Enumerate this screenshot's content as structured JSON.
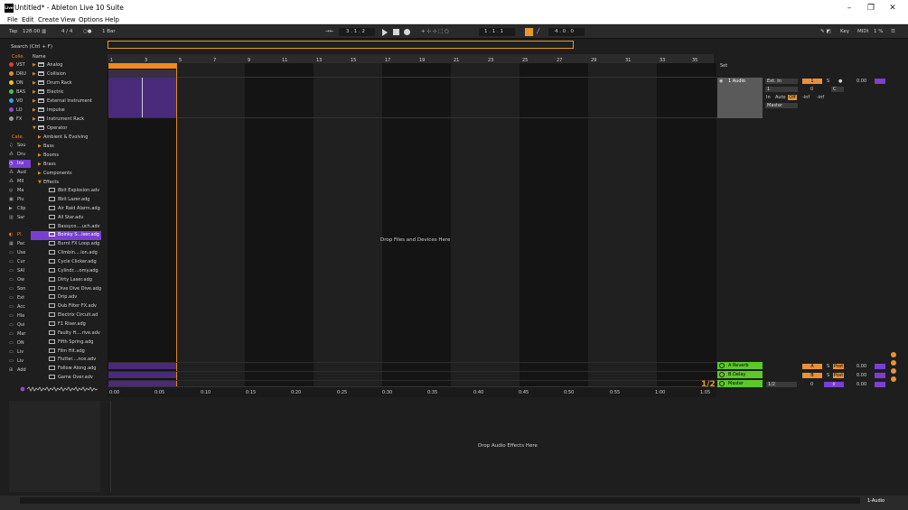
{
  "window": {
    "title": "Untitled* - Ableton Live 10 Suite",
    "app_icon": "Live",
    "minimize": "–",
    "maximize": "❐",
    "close": "✕"
  },
  "menu": [
    "File",
    "Edit",
    "Create",
    "View",
    "Options",
    "Help"
  ],
  "transport": {
    "tap": "Tap",
    "tempo": "128.00",
    "sig": "4 / 4",
    "quant": "1 Bar",
    "arr_pos": "3 .   1 .   2",
    "loop_pos": "1 .   1 .   1",
    "loop_len": "4 .   0 .   0",
    "key": "Key",
    "midi": "MIDI",
    "cpu": "1 %"
  },
  "browser": {
    "search": "Search (Ctrl + F)",
    "col_collections": "Colle.",
    "col_name": "Name",
    "collections": [
      {
        "label": "VST",
        "color": "#e23b3b"
      },
      {
        "label": "DRU",
        "color": "#e6892c"
      },
      {
        "label": "ON",
        "color": "#e6c42c"
      },
      {
        "label": "BAS",
        "color": "#4cc24a"
      },
      {
        "label": "VO",
        "color": "#3aa0e6"
      },
      {
        "label": "LO",
        "color": "#8a4ad6"
      },
      {
        "label": "FX",
        "color": "#9a9a9a"
      }
    ],
    "categories_head": "Cate.",
    "categories": [
      "Sou",
      "Dru",
      "Ins",
      "Aud",
      "MII",
      "Ma",
      "Plu",
      "Clip",
      "Sar"
    ],
    "places_head": "Pl.",
    "places": [
      "Pac",
      "Use",
      "Cur",
      "SAI",
      "Ow",
      "Son",
      "Ext",
      "Acc",
      "Hla",
      "Qui",
      "Mar",
      "DN",
      "Liv",
      "Liv",
      "Add"
    ],
    "items": [
      "Analog",
      "Collision",
      "Drum Rack",
      "Electric",
      "External Instrument",
      "Impulse",
      "Instrument Rack",
      "Operator",
      "Ambient & Evolving",
      "Bass",
      "Booms",
      "Brass",
      "Components",
      "Effects",
      "8bit Explosion.adv",
      "8bit Lazer.adg",
      "Air Raid Alarm.adg",
      "All Star.adv",
      "Bassyco....uch.adv",
      "Boinky S...iser.adg",
      "Burnt FX Loop.adg",
      "Climbin....ion.adg",
      "Cycle Clicker.adg",
      "Cylindr....omy.adg",
      "Dirty Laser.adg",
      "Dive Dive Dive.adg",
      "Drip.adv",
      "Dub Filter FX.adv",
      "Electrix Circuit.ad",
      "F1 Riser.adg",
      "Faulty H....rive.adv",
      "Fifth Spring.adg",
      "Film Hit.adg",
      "Flutter....nce.adv",
      "Follow Along.adg",
      "Game Over.adv"
    ]
  },
  "arrangement": {
    "bars": [
      "1",
      "3",
      "5",
      "7",
      "9",
      "11",
      "13",
      "15",
      "17",
      "19",
      "21",
      "23",
      "25",
      "27",
      "29",
      "31",
      "33",
      "35"
    ],
    "drop_files": "Drop Files and Devices Here",
    "times": [
      "0:00",
      "0:05",
      "0:10",
      "0:15",
      "0:20",
      "0:25",
      "0:30",
      "0:35",
      "0:40",
      "0:45",
      "0:50",
      "0:55",
      "1:00",
      "1:05"
    ],
    "page": "1/2"
  },
  "mixer": {
    "set": "Set",
    "track_name": "1 Audio",
    "input": "Ext. In",
    "input_ch": "1",
    "monitor_in": "In",
    "monitor_auto": "Auto",
    "monitor_off": "Off",
    "track_num": "1",
    "solo": "S",
    "pan": "C",
    "vol": "0",
    "inf1": "-inf",
    "inf2": "-inf",
    "db": "0.00",
    "output": "Master",
    "returns": [
      {
        "name": "A Reverb",
        "letter": "A",
        "post": "Post",
        "db": "0.00"
      },
      {
        "name": "B Delay",
        "letter": "B",
        "post": "Post",
        "db": "0.00"
      },
      {
        "name": "Master",
        "letter": "0",
        "post": "0",
        "db": "0.00",
        "sel": "1/2"
      }
    ]
  },
  "devices": {
    "drop_effects": "Drop Audio Effects Here"
  },
  "status": {
    "track": "1-Audio"
  }
}
